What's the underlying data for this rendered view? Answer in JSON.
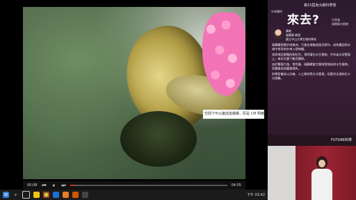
{
  "video": {
    "caption": "空間下可以繼成金蘋螺，原是 CM 明確因素",
    "time_current": "00:08",
    "time_total": "04:05"
  },
  "sidebar": {
    "event_title": "第15屆吳大猷科學營",
    "small_title": "外來種的",
    "big_title": "來去?",
    "side_note": "分享者\n福爾摩沙植物",
    "speaker_info": "講者\n福爾摩 教授\n國立中山大學生物科學系",
    "article": [
      "福壽螺原產於南美洲，引進台灣後逃逸至野外，成為農田與水域中常見的外來入侵物種。",
      "其卵塊呈鮮豔的粉紅色，常附著在水生植物、竹竿或水泥壁面上，每次可產下數百顆卵。",
      "由於繁殖力強、食性廣，福壽螺會大量啃食秧苗與水生植物，對農業造成嚴重損失。",
      "科學家嘗試以天敵、人工移除等方式管理，但要完全清除仍十分困難。"
    ],
    "banner_logo": "FUTURE科學"
  },
  "taskbar": {
    "icons": [
      "start-icon",
      "search-icon",
      "task-view-icon",
      "file-explorer-icon",
      "browser-icon",
      "mail-icon",
      "media-icon",
      "slides-icon",
      "video-icon"
    ],
    "tray_time": "下午 03:42"
  }
}
